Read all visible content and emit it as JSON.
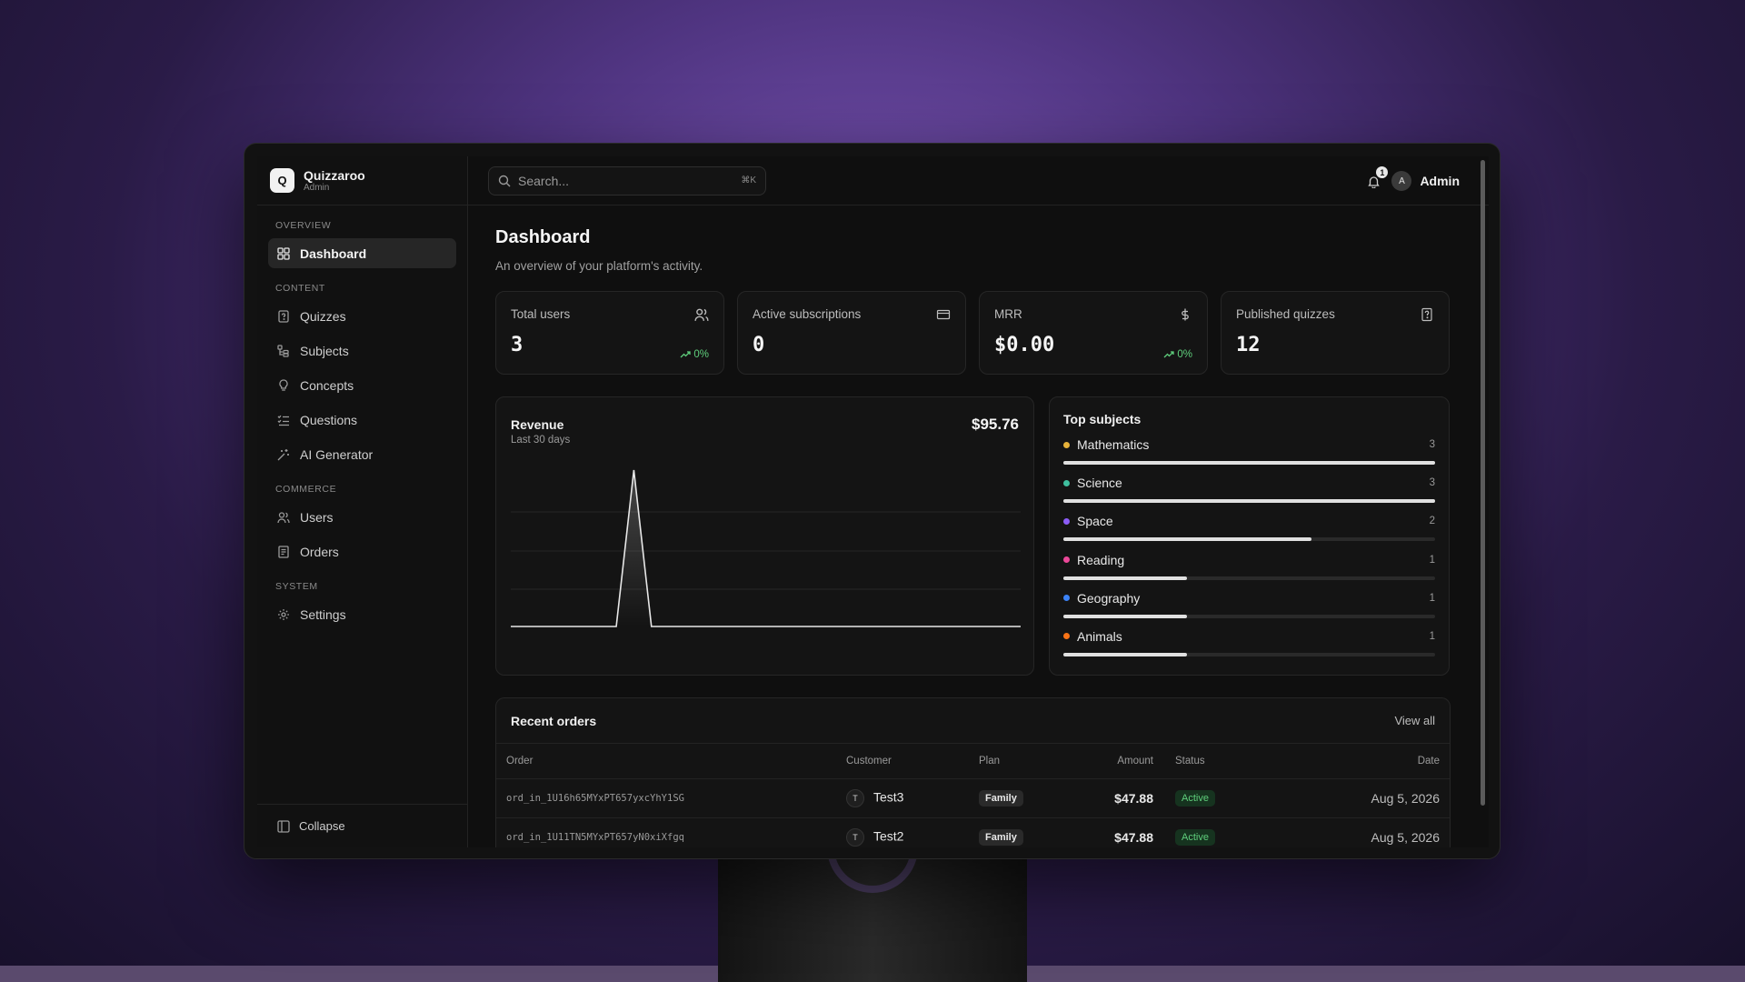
{
  "brand": {
    "logo_letter": "Q",
    "name": "Quizzaroo",
    "role": "Admin"
  },
  "sidebar": {
    "sections": [
      {
        "label": "OVERVIEW",
        "items": [
          {
            "label": "Dashboard",
            "icon": "dashboard-icon",
            "active": true
          }
        ]
      },
      {
        "label": "CONTENT",
        "items": [
          {
            "label": "Quizzes",
            "icon": "quiz-icon"
          },
          {
            "label": "Subjects",
            "icon": "subjects-icon"
          },
          {
            "label": "Concepts",
            "icon": "lightbulb-icon"
          },
          {
            "label": "Questions",
            "icon": "list-check-icon"
          },
          {
            "label": "AI Generator",
            "icon": "sparkles-icon"
          }
        ]
      },
      {
        "label": "COMMERCE",
        "items": [
          {
            "label": "Users",
            "icon": "users-icon"
          },
          {
            "label": "Orders",
            "icon": "receipt-icon"
          }
        ]
      },
      {
        "label": "SYSTEM",
        "items": [
          {
            "label": "Settings",
            "icon": "gear-icon"
          }
        ]
      }
    ],
    "collapse_label": "Collapse"
  },
  "search": {
    "placeholder": "Search...",
    "shortcut": "⌘K"
  },
  "topbar": {
    "notification_count": "1",
    "user_initial": "A",
    "user_name": "Admin"
  },
  "page": {
    "title": "Dashboard",
    "subtitle": "An overview of your platform's activity."
  },
  "stats": [
    {
      "label": "Total users",
      "value": "3",
      "trend": "0%",
      "icon": "users-icon"
    },
    {
      "label": "Active subscriptions",
      "value": "0",
      "trend": "",
      "icon": "credit-card-icon"
    },
    {
      "label": "MRR",
      "value": "$0.00",
      "trend": "0%",
      "icon": "dollar-icon"
    },
    {
      "label": "Published quizzes",
      "value": "12",
      "trend": "",
      "icon": "document-icon"
    }
  ],
  "revenue": {
    "title": "Revenue",
    "subtitle": "Last 30 days",
    "total": "$95.76"
  },
  "chart_data": {
    "type": "area",
    "title": "Revenue",
    "subtitle": "Last 30 days",
    "x": [
      1,
      2,
      3,
      4,
      5,
      6,
      7,
      8,
      9,
      10,
      11,
      12,
      13,
      14,
      15,
      16,
      17,
      18,
      19,
      20,
      21,
      22,
      23,
      24,
      25,
      26,
      27,
      28,
      29,
      30
    ],
    "values": [
      0,
      0,
      0,
      0,
      0,
      0,
      0,
      95.76,
      0,
      0,
      0,
      0,
      0,
      0,
      0,
      0,
      0,
      0,
      0,
      0,
      0,
      0,
      0,
      0,
      0,
      0,
      0,
      0,
      0,
      0
    ],
    "ylim": [
      0,
      95.76
    ],
    "grid": true
  },
  "top_subjects": {
    "title": "Top subjects",
    "items": [
      {
        "name": "Mathematics",
        "count": 3,
        "color": "#e6b23a"
      },
      {
        "name": "Science",
        "count": 3,
        "color": "#3fbf9f"
      },
      {
        "name": "Space",
        "count": 2,
        "color": "#8b5cf6"
      },
      {
        "name": "Reading",
        "count": 1,
        "color": "#ec4899"
      },
      {
        "name": "Geography",
        "count": 1,
        "color": "#3b82f6"
      },
      {
        "name": "Animals",
        "count": 1,
        "color": "#f97316"
      }
    ],
    "max": 3
  },
  "orders": {
    "title": "Recent orders",
    "view_all": "View all",
    "columns": [
      "Order",
      "Customer",
      "Plan",
      "Amount",
      "Status",
      "Date"
    ],
    "rows": [
      {
        "order": "ord_in_1U16h65MYxPT657yxcYhY1SG",
        "initial": "T",
        "customer": "Test3",
        "plan": "Family",
        "amount": "$47.88",
        "status": "Active",
        "date": "Aug 5, 2026"
      },
      {
        "order": "ord_in_1U11TN5MYxPT657yN0xiXfgq",
        "initial": "T",
        "customer": "Test2",
        "plan": "Family",
        "amount": "$47.88",
        "status": "Active",
        "date": "Aug 5, 2026"
      }
    ]
  },
  "colors": {
    "accent_green": "#5fcf7c",
    "background": "#0f0f0f",
    "card": "#141414"
  }
}
